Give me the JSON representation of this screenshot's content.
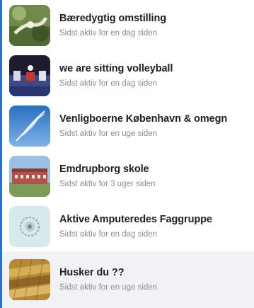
{
  "groups": [
    {
      "name": "Bæredygtig omstilling",
      "status": "Sidst aktiv for en dag siden",
      "thumbnail": "sustainability-photo"
    },
    {
      "name": "we are sitting volleyball",
      "status": "Sidst aktiv for en dag siden",
      "thumbnail": "volleyball-photo"
    },
    {
      "name": "Venligboerne København & omegn",
      "status": "Sidst aktiv for en uge siden",
      "thumbnail": "feather-photo"
    },
    {
      "name": "Emdrupborg skole",
      "status": "Sidst aktiv for 3 uger siden",
      "thumbnail": "school-building-photo"
    },
    {
      "name": "Aktive Amputeredes Faggruppe",
      "status": "Sidst aktiv for en dag siden",
      "thumbnail": "amputee-logo"
    },
    {
      "name": "Husker du ??",
      "status": "Sidst aktiv for en uge siden",
      "thumbnail": "wheat-field-photo"
    }
  ],
  "colors": {
    "accent_border": "#2a6fd6",
    "hover_row": "#f0f2f5",
    "name_text": "#1c1e21",
    "status_text": "#8a8d91"
  }
}
